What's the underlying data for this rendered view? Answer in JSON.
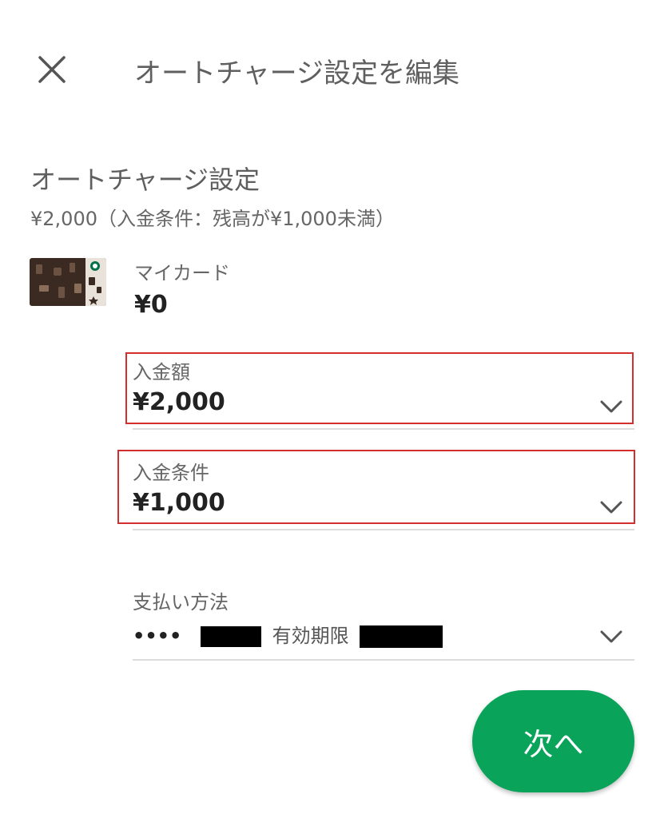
{
  "header": {
    "title": "オートチャージ設定を編集",
    "close_icon": "close-icon"
  },
  "section": {
    "title": "オートチャージ設定",
    "summary": "¥2,000（入金条件：残高が¥1,000未満）"
  },
  "card": {
    "name": "マイカード",
    "balance": "¥0",
    "image": "starbucks-card-image"
  },
  "amount_field": {
    "label": "入金額",
    "value": "¥2,000",
    "icon": "chevron-down-icon"
  },
  "condition_field": {
    "label": "入金条件",
    "value": "¥1,000",
    "icon": "chevron-down-icon"
  },
  "payment_field": {
    "label": "支払い方法",
    "card_dots": "••••",
    "expiry_label": "有効期限",
    "icon": "chevron-down-icon"
  },
  "next_button": {
    "label": "次へ"
  },
  "colors": {
    "accent_green": "#0aa35a",
    "highlight_red": "#d32f2f",
    "text_dark": "#222222",
    "text_gray": "#666666"
  }
}
